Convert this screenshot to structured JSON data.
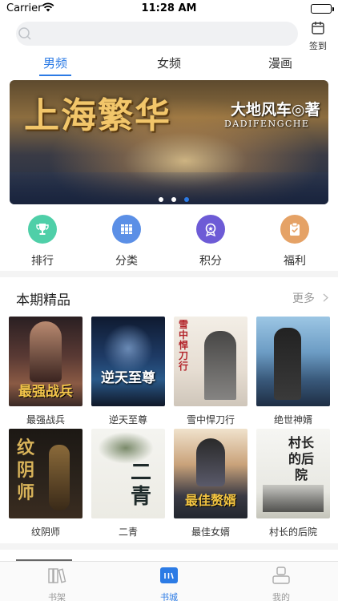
{
  "status_bar": {
    "carrier": "Carrier",
    "time": "11:28 AM"
  },
  "search": {
    "placeholder": ""
  },
  "checkin": {
    "label": "签到"
  },
  "channel_tabs": [
    {
      "label": "男频",
      "active": true
    },
    {
      "label": "女频",
      "active": false
    },
    {
      "label": "漫画",
      "active": false
    }
  ],
  "banner": {
    "title": "上海繁华",
    "author": "大地风车◎著",
    "pinyin": "DADIFENGCHE",
    "active_dot": 3,
    "dot_count": 3
  },
  "quick_nav": [
    {
      "label": "排行",
      "icon": "trophy-icon",
      "color": "#4fcfa8"
    },
    {
      "label": "分类",
      "icon": "books-category-icon",
      "color": "#5b8fe6"
    },
    {
      "label": "积分",
      "icon": "medal-points-icon",
      "color": "#6d5bd6"
    },
    {
      "label": "福利",
      "icon": "gift-clipboard-icon",
      "color": "#e5a266"
    }
  ],
  "featured": {
    "title": "本期精品",
    "more_label": "更多",
    "books": [
      {
        "name": "最强战兵",
        "cover_text": "最强战兵",
        "colors": [
          "#3a2a2a",
          "#7a4a3a"
        ]
      },
      {
        "name": "逆天至尊",
        "cover_text": "逆天至尊",
        "colors": [
          "#1a2a4a",
          "#3a6a9a"
        ]
      },
      {
        "name": "雪中悍刀行",
        "cover_text": "雪中悍刀行",
        "colors": [
          "#f1ebe3",
          "#c9c0b4"
        ]
      },
      {
        "name": "绝世神婿",
        "cover_text": "",
        "colors": [
          "#7fb4d8",
          "#2c4a6a"
        ]
      },
      {
        "name": "纹阴师",
        "cover_text": "纹阴师",
        "colors": [
          "#2a2520",
          "#4a3a2a"
        ]
      },
      {
        "name": "二青",
        "cover_text": "二青",
        "colors": [
          "#f3f3ef",
          "#d8d8d0"
        ]
      },
      {
        "name": "最佳女婿",
        "cover_text": "最佳赘婿",
        "colors": [
          "#2a2f3a",
          "#b06a30"
        ]
      },
      {
        "name": "村长的后院",
        "cover_text": "村长的后院",
        "colors": [
          "#f5f5f2",
          "#c8c8c0"
        ]
      }
    ]
  },
  "tab_bar": [
    {
      "label": "书架",
      "active": false
    },
    {
      "label": "书城",
      "active": true
    },
    {
      "label": "我的",
      "active": false
    }
  ],
  "accent_color": "#2c7be5"
}
